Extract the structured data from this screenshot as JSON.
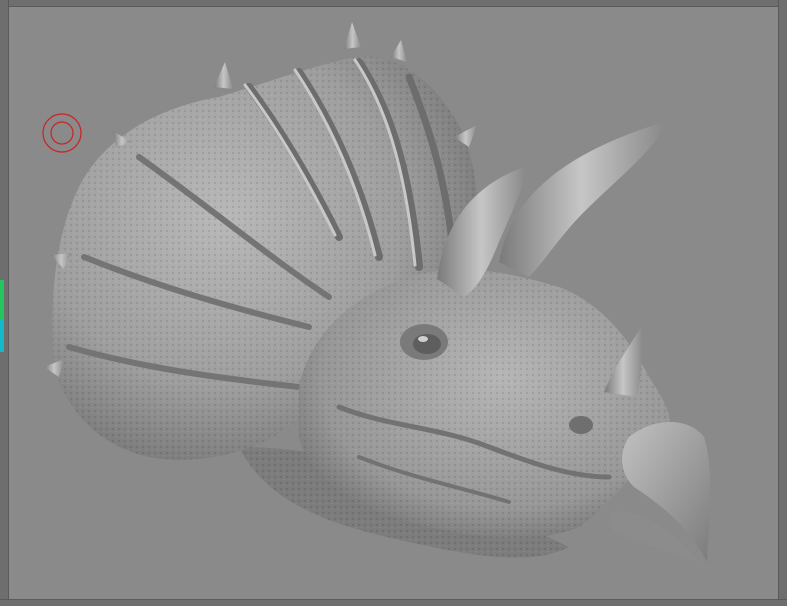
{
  "app": {
    "viewport_background": "#8a8a8a",
    "frame_color": "#6e6e6e",
    "accent_colors": [
      "#22c55e",
      "#14b8c8"
    ]
  },
  "brush": {
    "icon": "brush-cursor-icon",
    "color": "#cc2222"
  },
  "model": {
    "subject": "triceratops-head-sculpt",
    "surface_color": "#a6a6a6"
  }
}
